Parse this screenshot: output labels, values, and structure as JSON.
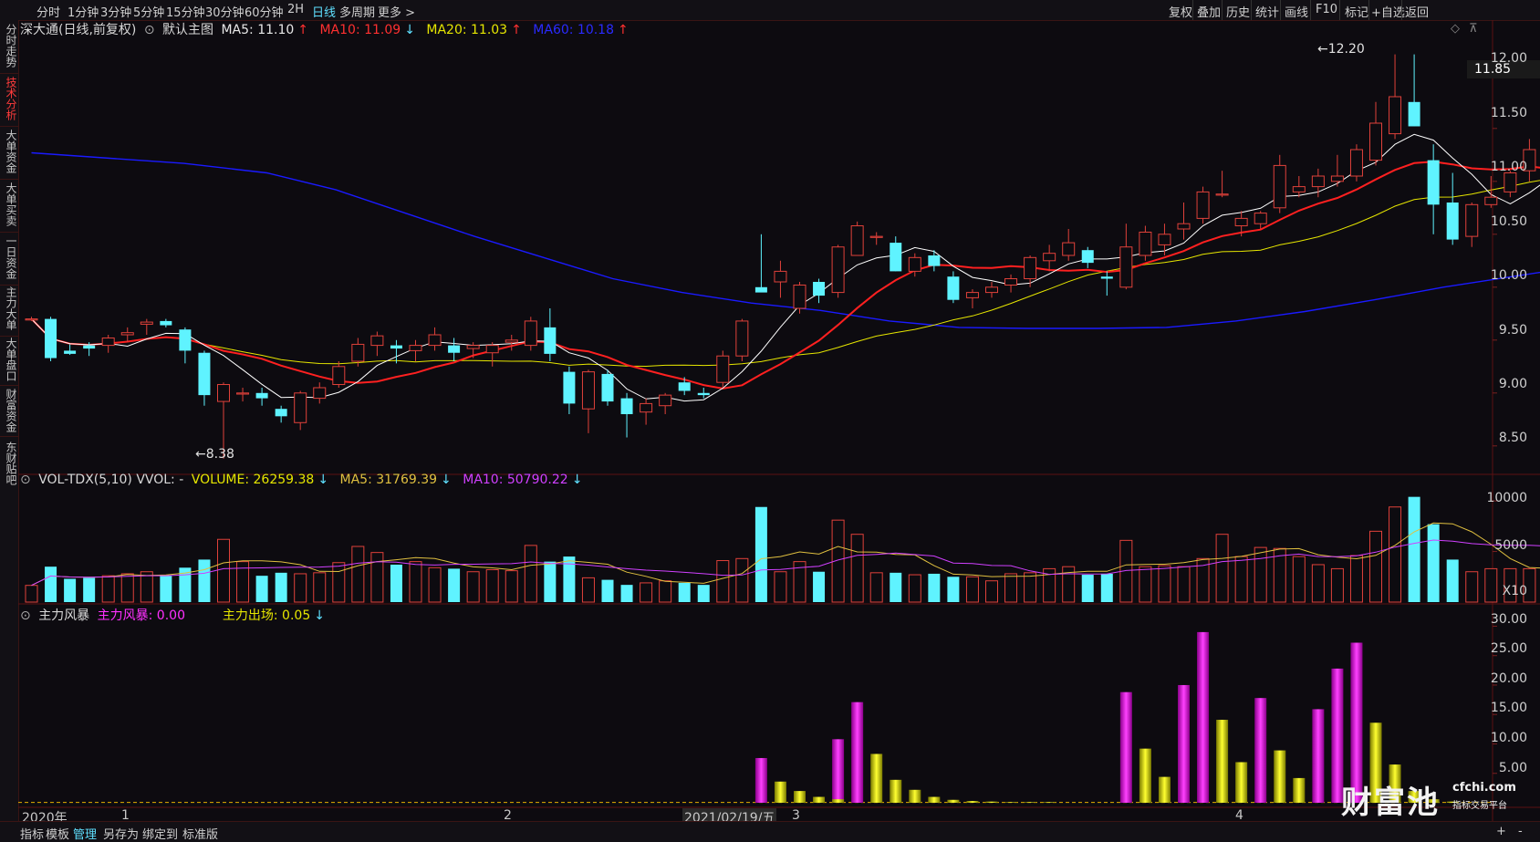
{
  "topbar": {
    "periods": [
      "分时",
      "1分钟",
      "3分钟",
      "5分钟",
      "15分钟",
      "30分钟",
      "60分钟",
      "2H",
      "日线",
      "多周期",
      "更多 >"
    ],
    "active_period": "日线",
    "tools": [
      "复权",
      "叠加",
      "历史",
      "统计",
      "画线",
      "F10",
      "标记",
      "+自选",
      "返回"
    ]
  },
  "left_tabs": [
    "分时走势",
    "技术分析",
    "大单资金",
    "大单买卖",
    "一日资金",
    "主力大单",
    "大单盘口",
    "财富资金",
    "东财贴吧"
  ],
  "active_left_tab": "技术分析",
  "price_panel": {
    "stock": "深大通(日线,前复权)",
    "main_label": "默认主图",
    "ma5": "MA5: 11.10",
    "ma10": "MA10: 11.09",
    "ma20": "MA20: 11.03",
    "ma60": "MA60: 10.18",
    "ma5_arrow": "↑",
    "ma10_arrow": "↓",
    "ma20_arrow": "↑",
    "ma60_arrow": "↑",
    "high_label": "12.20",
    "low_label": "8.38",
    "current_price": "11.85",
    "y_ticks": [
      "12.00",
      "11.50",
      "11.00",
      "10.50",
      "10.00",
      "9.50",
      "9.00",
      "8.50"
    ]
  },
  "volume_panel": {
    "label": "VOL-TDX(5,10) VVOL: -",
    "volume": "VOLUME: 26259.38",
    "ma5": "MA5: 31769.39",
    "ma10": "MA10: 50790.22",
    "arrow": "↓",
    "y_ticks": [
      "10000",
      "5000"
    ],
    "unit": "X10"
  },
  "indicator_panel": {
    "label": "主力风暴",
    "storm": "主力风暴: 0.00",
    "exit": "主力出场: 0.05",
    "arrow": "↓",
    "y_ticks": [
      "30.00",
      "25.00",
      "20.00",
      "15.00",
      "10.00",
      "5.00"
    ]
  },
  "x_axis": {
    "labels": [
      "2020年",
      "1",
      "2",
      "2021/02/19/五",
      "3",
      "4"
    ]
  },
  "bottombar": {
    "tabs": [
      "指标",
      "模板",
      "管理",
      "另存为",
      "绑定到",
      "标准版"
    ],
    "active": "管理",
    "right_buttons": [
      "+",
      "-"
    ]
  },
  "watermark": {
    "name": "财富池",
    "domain": "cfchi.com",
    "slogan": "指标交易平台"
  },
  "colors": {
    "up": "#e0413a",
    "down": "#5ff3ff",
    "ma5": "#ffffff",
    "ma10": "#ff2020",
    "ma20": "#e6e600",
    "ma60": "#1a1aff",
    "storm": "#ff20ff",
    "exit": "#e6e600",
    "vol_ma5": "#e0c040",
    "vol_ma10": "#d040ff"
  },
  "chart_data": {
    "type": "candlestick",
    "y_range": [
      8.3,
      12.3
    ],
    "candles": [
      [
        9.7,
        9.72,
        9.68,
        9.7
      ],
      [
        9.7,
        9.72,
        9.3,
        9.33
      ],
      [
        9.4,
        9.46,
        9.36,
        9.37
      ],
      [
        9.45,
        9.48,
        9.35,
        9.42
      ],
      [
        9.45,
        9.55,
        9.38,
        9.52
      ],
      [
        9.55,
        9.62,
        9.48,
        9.57
      ],
      [
        9.65,
        9.7,
        9.55,
        9.67
      ],
      [
        9.68,
        9.7,
        9.62,
        9.64
      ],
      [
        9.6,
        9.62,
        9.28,
        9.4
      ],
      [
        9.38,
        9.4,
        8.88,
        8.98
      ],
      [
        8.92,
        9.1,
        8.38,
        9.08
      ],
      [
        9.0,
        9.05,
        8.92,
        9.0
      ],
      [
        9.0,
        9.05,
        8.88,
        8.95
      ],
      [
        8.85,
        8.88,
        8.72,
        8.78
      ],
      [
        8.72,
        9.02,
        8.65,
        9.0
      ],
      [
        8.95,
        9.1,
        8.9,
        9.05
      ],
      [
        9.08,
        9.3,
        9.05,
        9.25
      ],
      [
        9.3,
        9.52,
        9.25,
        9.46
      ],
      [
        9.45,
        9.58,
        9.35,
        9.54
      ],
      [
        9.45,
        9.5,
        9.28,
        9.42
      ],
      [
        9.4,
        9.5,
        9.3,
        9.45
      ],
      [
        9.45,
        9.62,
        9.4,
        9.55
      ],
      [
        9.45,
        9.52,
        9.3,
        9.38
      ],
      [
        9.42,
        9.48,
        9.33,
        9.45
      ],
      [
        9.38,
        9.48,
        9.25,
        9.45
      ],
      [
        9.48,
        9.55,
        9.4,
        9.5
      ],
      [
        9.45,
        9.72,
        9.4,
        9.68
      ],
      [
        9.62,
        9.8,
        9.3,
        9.37
      ],
      [
        9.2,
        9.25,
        8.8,
        8.9
      ],
      [
        8.85,
        9.22,
        8.62,
        9.2
      ],
      [
        9.18,
        9.22,
        8.88,
        8.92
      ],
      [
        8.95,
        9.0,
        8.58,
        8.8
      ],
      [
        8.82,
        8.95,
        8.7,
        8.9
      ],
      [
        8.88,
        9.0,
        8.8,
        8.98
      ],
      [
        9.1,
        9.15,
        8.98,
        9.02
      ],
      [
        9.0,
        9.05,
        8.95,
        8.98
      ],
      [
        9.1,
        9.4,
        9.05,
        9.35
      ],
      [
        9.35,
        9.7,
        9.3,
        9.68
      ],
      [
        10.0,
        10.5,
        9.98,
        9.95
      ],
      [
        10.05,
        10.25,
        9.9,
        10.15
      ],
      [
        9.8,
        10.05,
        9.75,
        10.02
      ],
      [
        10.05,
        10.08,
        9.85,
        9.92
      ],
      [
        9.95,
        10.4,
        9.9,
        10.38
      ],
      [
        10.3,
        10.62,
        10.3,
        10.58
      ],
      [
        10.48,
        10.52,
        10.4,
        10.48
      ],
      [
        10.42,
        10.48,
        10.15,
        10.15
      ],
      [
        10.15,
        10.32,
        10.1,
        10.28
      ],
      [
        10.3,
        10.35,
        10.15,
        10.2
      ],
      [
        10.1,
        10.15,
        9.85,
        9.88
      ],
      [
        9.9,
        9.98,
        9.8,
        9.95
      ],
      [
        9.95,
        10.05,
        9.9,
        10.0
      ],
      [
        10.02,
        10.12,
        9.95,
        10.08
      ],
      [
        10.08,
        10.3,
        10.0,
        10.28
      ],
      [
        10.25,
        10.4,
        10.15,
        10.32
      ],
      [
        10.3,
        10.55,
        10.25,
        10.42
      ],
      [
        10.35,
        10.38,
        10.18,
        10.23
      ],
      [
        10.1,
        10.15,
        9.92,
        10.08
      ],
      [
        10.0,
        10.6,
        9.98,
        10.38
      ],
      [
        10.3,
        10.58,
        10.25,
        10.52
      ],
      [
        10.4,
        10.6,
        10.3,
        10.5
      ],
      [
        10.55,
        10.8,
        10.45,
        10.6
      ],
      [
        10.65,
        10.95,
        10.6,
        10.9
      ],
      [
        10.88,
        11.1,
        10.85,
        10.88
      ],
      [
        10.58,
        10.72,
        10.48,
        10.65
      ],
      [
        10.6,
        10.72,
        10.55,
        10.7
      ],
      [
        10.75,
        11.25,
        10.7,
        11.15
      ],
      [
        10.9,
        11.05,
        10.85,
        10.95
      ],
      [
        10.95,
        11.12,
        10.85,
        11.05
      ],
      [
        11.0,
        11.25,
        10.95,
        11.05
      ],
      [
        11.05,
        11.35,
        11.0,
        11.3
      ],
      [
        11.2,
        11.75,
        11.15,
        11.55
      ],
      [
        11.45,
        12.2,
        11.4,
        11.8
      ],
      [
        11.75,
        12.2,
        11.52,
        11.52
      ],
      [
        11.2,
        11.35,
        10.5,
        10.78
      ],
      [
        10.8,
        11.08,
        10.4,
        10.45
      ],
      [
        10.48,
        10.8,
        10.38,
        10.78
      ],
      [
        10.78,
        11.05,
        10.75,
        10.85
      ],
      [
        10.9,
        11.1,
        10.85,
        11.08
      ],
      [
        11.1,
        11.4,
        11.0,
        11.3
      ],
      [
        11.28,
        11.45,
        10.95,
        11.1
      ],
      [
        11.1,
        11.2,
        10.9,
        10.98
      ]
    ],
    "volumes": [
      1650,
      3500,
      2300,
      2400,
      2600,
      2800,
      3000,
      2600,
      3400,
      4200,
      6200,
      4000,
      2600,
      2900,
      2800,
      2900,
      3900,
      5500,
      4900,
      3700,
      4000,
      3400,
      3300,
      3000,
      3200,
      3100,
      5600,
      4000,
      4500,
      2400,
      2200,
      1700,
      1900,
      2100,
      1900,
      1700,
      4100,
      4300,
      9400,
      3000,
      4000,
      3000,
      8100,
      6700,
      2900,
      2900,
      2700,
      2800,
      2500,
      2500,
      2100,
      2800,
      2900,
      3300,
      3500,
      2700,
      2800,
      6100,
      3500,
      3600,
      3500,
      4300,
      6700,
      4500,
      5400,
      5300,
      4500,
      3700,
      3300,
      4600,
      7000,
      9400,
      10400,
      7700,
      4200,
      3000,
      3300,
      3300,
      3300,
      3800,
      2700
    ],
    "storm": [
      0,
      0,
      0,
      0,
      0,
      0,
      0,
      0,
      0,
      0,
      0,
      0,
      0,
      0,
      0,
      0,
      0,
      0,
      0,
      0,
      0,
      0,
      0,
      0,
      0,
      0,
      0,
      0,
      0,
      0,
      0,
      0,
      0,
      0,
      0,
      0,
      0,
      0,
      7.6,
      0,
      0,
      0,
      10.8,
      17.1,
      0,
      0,
      0,
      0,
      0,
      0,
      0,
      0,
      0,
      0,
      0,
      0,
      0,
      18.8,
      0,
      0,
      20.0,
      29.0,
      0,
      0,
      17.8,
      0,
      0,
      15.9,
      22.8,
      27.2,
      0,
      0,
      0,
      0,
      0,
      0,
      0,
      0,
      0,
      0,
      0
    ],
    "exit": [
      0.05,
      0.05,
      0.05,
      0.05,
      0.05,
      0.05,
      0.05,
      0.05,
      0.05,
      0.05,
      0.05,
      0.05,
      0.05,
      0.05,
      0.05,
      0.05,
      0.05,
      0.05,
      0.05,
      0.05,
      0.05,
      0.05,
      0.05,
      0.05,
      0.05,
      0.05,
      0.05,
      0.05,
      0.05,
      0.05,
      0.05,
      0.05,
      0.05,
      0.05,
      0.05,
      0.05,
      0.05,
      0.05,
      0,
      3.6,
      2.0,
      1.0,
      0.6,
      0,
      8.3,
      3.9,
      2.2,
      1.0,
      0.5,
      0.3,
      0.2,
      0.1,
      0.1,
      0.1,
      0.05,
      0.05,
      0.05,
      0,
      9.2,
      4.4,
      0,
      0,
      14.1,
      6.9,
      0,
      8.9,
      4.2,
      0,
      0,
      0,
      13.6,
      6.5,
      2.0,
      0.6,
      0.2,
      0.05,
      0.05,
      0.05,
      0.05,
      0.05,
      0.05
    ],
    "ma60": [
      [
        10.98,
        11.27
      ],
      [
        11.2,
        11.17
      ],
      [
        11.32,
        11.08
      ],
      [
        11.42,
        10.92
      ],
      [
        11.52,
        10.7
      ],
      [
        11.62,
        10.48
      ],
      [
        11.72,
        10.28
      ],
      [
        11.82,
        10.08
      ],
      [
        11.92,
        9.95
      ],
      [
        12.02,
        9.85
      ],
      [
        12.12,
        9.78
      ],
      [
        12.22,
        9.68
      ],
      [
        12.32,
        9.62
      ],
      [
        12.42,
        9.61
      ],
      [
        12.52,
        9.61
      ],
      [
        12.62,
        9.62
      ],
      [
        12.72,
        9.68
      ],
      [
        12.82,
        9.77
      ],
      [
        12.92,
        9.88
      ],
      [
        13.02,
        10.0
      ],
      [
        13.12,
        10.1
      ],
      [
        13.2,
        10.18
      ]
    ]
  }
}
